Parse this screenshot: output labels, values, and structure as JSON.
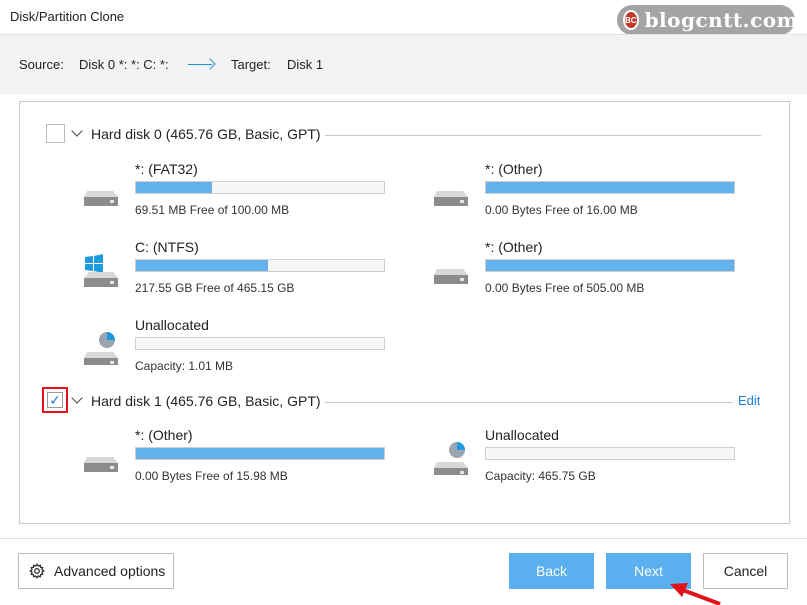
{
  "window": {
    "title": "Disk/Partition Clone"
  },
  "watermark": {
    "logo": "BC",
    "text": "blogcntt.com"
  },
  "source_bar": {
    "source_label": "Source:",
    "source_value": "Disk 0 *: *: C: *:",
    "target_label": "Target:",
    "target_value": "Disk 1"
  },
  "disks": [
    {
      "title": "Hard disk 0 (465.76 GB, Basic, GPT)",
      "checked": false,
      "partitions": [
        {
          "name": "*: (FAT32)",
          "info": "69.51 MB Free of 100.00 MB",
          "used_fraction": 0.305,
          "icon": "drive-icon"
        },
        {
          "name": "*: (Other)",
          "info": "0.00 Bytes Free of 16.00 MB",
          "used_fraction": 1.0,
          "icon": "drive-icon"
        },
        {
          "name": "C: (NTFS)",
          "info": "217.55 GB Free of 465.15 GB",
          "used_fraction": 0.532,
          "icon": "windows-drive-icon"
        },
        {
          "name": "*: (Other)",
          "info": "0.00 Bytes Free of 505.00 MB",
          "used_fraction": 1.0,
          "icon": "drive-icon"
        },
        {
          "name": "Unallocated",
          "info": "Capacity: 1.01 MB",
          "used_fraction": 0.0,
          "icon": "unallocated-drive-icon"
        }
      ]
    },
    {
      "title": "Hard disk 1 (465.76 GB, Basic, GPT)",
      "checked": true,
      "check_mark": "✓",
      "edit_label": "Edit",
      "partitions": [
        {
          "name": "*: (Other)",
          "info": "0.00 Bytes Free of 15.98 MB",
          "used_fraction": 1.0,
          "icon": "drive-icon"
        },
        {
          "name": "Unallocated",
          "info": "Capacity: 465.75 GB",
          "used_fraction": 0.0,
          "icon": "unallocated-drive-icon"
        }
      ]
    }
  ],
  "footer": {
    "advanced_label": "Advanced options",
    "back_label": "Back",
    "next_label": "Next",
    "cancel_label": "Cancel"
  },
  "colors": {
    "accent": "#5ab0ee",
    "bar_fill": "#63b2ee",
    "link": "#1e7fd6",
    "highlight": "#e0121b"
  }
}
